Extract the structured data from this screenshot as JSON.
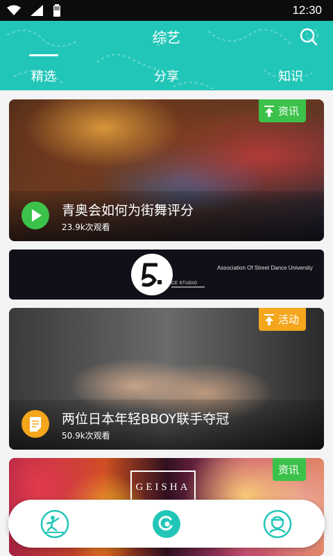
{
  "status_bar": {
    "time": "12:30"
  },
  "header": {
    "title": "综艺",
    "background_color": "#22c6b8"
  },
  "tabs": [
    {
      "label": "精选",
      "selected": true
    },
    {
      "label": "分享",
      "selected": false
    },
    {
      "label": "知识",
      "selected": false
    }
  ],
  "cards": [
    {
      "badge": "资讯",
      "badge_color": "#3cc24a",
      "title": "青奥会如何为街舞评分",
      "views": "23.9k次观看",
      "icon": "play-icon"
    },
    {
      "badge": "活动",
      "badge_color": "#f4a61c",
      "title": "两位日本年轻BBOY联手夺冠",
      "views": "50.9k次观看",
      "icon": "note-icon"
    },
    {
      "badge": "资讯",
      "badge_color": "#3cc24a"
    }
  ],
  "banner": {
    "logo_text": "DANCE STUDIO",
    "overlay_text": "Association Of Street Dance University"
  },
  "geisha_text": "GEISHA",
  "bottom_nav": [
    {
      "icon": "dancer-icon"
    },
    {
      "icon": "home-icon"
    },
    {
      "icon": "profile-icon"
    }
  ]
}
